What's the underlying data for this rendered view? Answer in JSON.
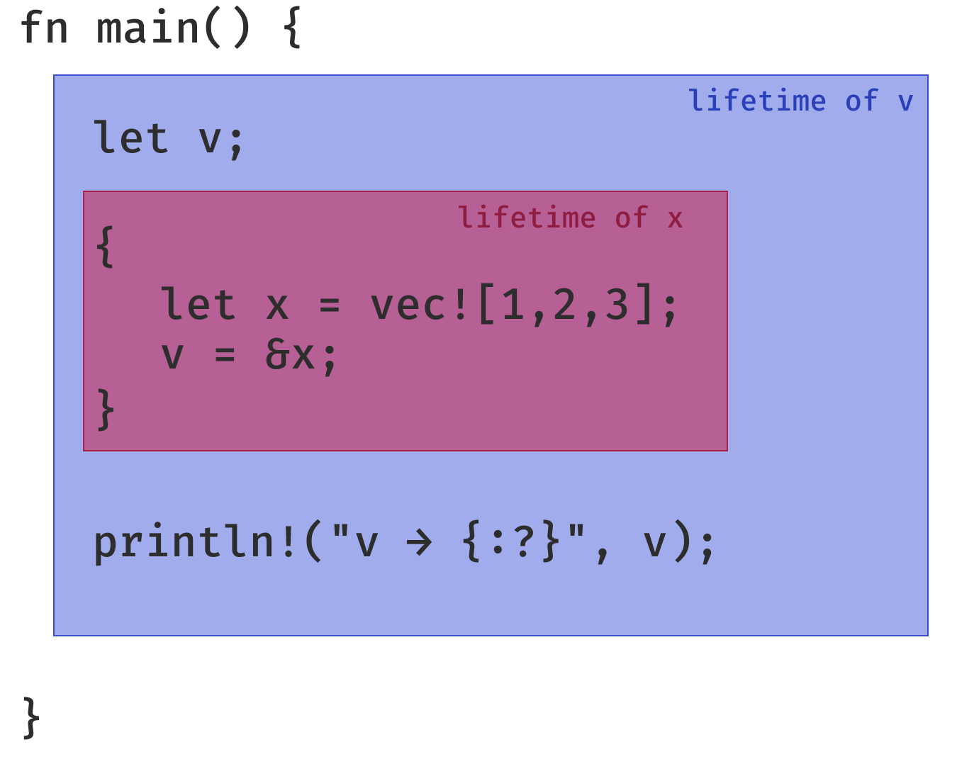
{
  "code": {
    "line1": "fn main() {",
    "line2": "let v;",
    "line3": "{",
    "line4": "let x = vec![1,2,3];",
    "line5": "v = &x;",
    "line6": "}",
    "line7": "println!(\"v → {:?}\", v);",
    "line8": "}"
  },
  "labels": {
    "outer": "lifetime of v",
    "inner": "lifetime of x"
  },
  "colors": {
    "outer_fill": "rgba(82,103,221,0.55)",
    "outer_border": "#3a4fc9",
    "inner_fill": "rgba(200,35,80,0.55)",
    "inner_border": "#a8244a",
    "outer_label": "#2a3fb8",
    "inner_label": "#8f1d42",
    "code": "#2d2d2d"
  }
}
